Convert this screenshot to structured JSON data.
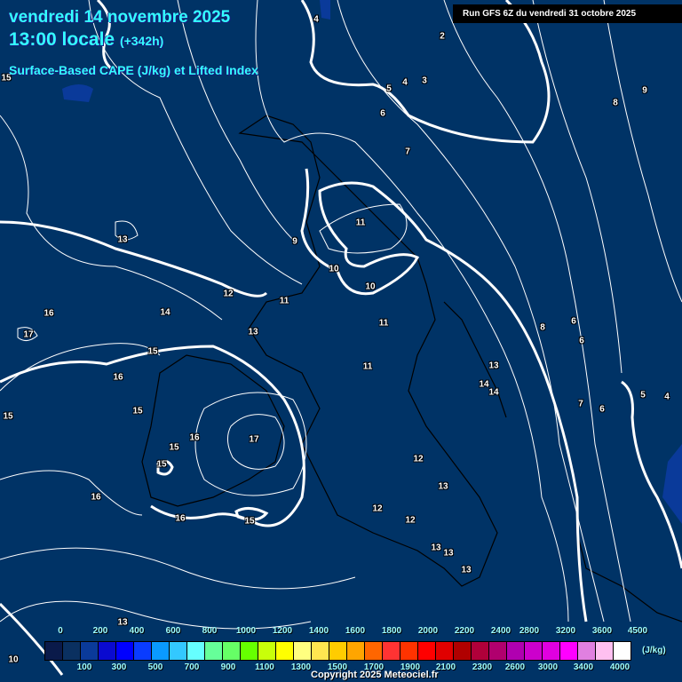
{
  "header": {
    "date": "vendredi 14 novembre 2025",
    "time": "13:00 locale",
    "lead": "(+342h)",
    "parameter": "Surface-Based CAPE (J/kg) et Lifted Index",
    "run": "Run GFS 6Z du vendredi 31 octobre 2025"
  },
  "colors": {
    "background": "#003366",
    "contour": "#ffffff",
    "coastline": "#000000",
    "cape_patch": "#0a3a9a"
  },
  "contour_labels": [
    4,
    2,
    5,
    4,
    3,
    15,
    6,
    7,
    8,
    9,
    11,
    13,
    9,
    10,
    10,
    12,
    11,
    16,
    14,
    11,
    6,
    8,
    6,
    17,
    13,
    15,
    11,
    13,
    16,
    14,
    14,
    5,
    4,
    7,
    6,
    15,
    15,
    16,
    17,
    15,
    15,
    12,
    13,
    16,
    12,
    12,
    16,
    15,
    13,
    13,
    13,
    13,
    10
  ],
  "legend": {
    "unit": "(J/kg)",
    "top_labels": [
      "0",
      "200",
      "400",
      "600",
      "800",
      "1000",
      "1200",
      "1400",
      "1600",
      "1800",
      "2000",
      "2200",
      "2400",
      "2800",
      "3200",
      "3600",
      "4500"
    ],
    "bottom_labels": [
      "100",
      "300",
      "500",
      "700",
      "900",
      "1100",
      "1300",
      "1500",
      "1700",
      "1900",
      "2100",
      "2300",
      "2600",
      "3000",
      "3400",
      "4000"
    ],
    "swatches": [
      "#0a1a4a",
      "#0a3060",
      "#0a3a9a",
      "#0a0ad0",
      "#0000ff",
      "#0a3cff",
      "#0a9aff",
      "#33c8ff",
      "#66ffff",
      "#66ff99",
      "#66ff66",
      "#66ff00",
      "#c8ff0a",
      "#ffff00",
      "#ffff80",
      "#ffe650",
      "#ffcc00",
      "#ffa500",
      "#ff6600",
      "#ff3333",
      "#ff3300",
      "#ff0000",
      "#e00000",
      "#b00000",
      "#b0003a",
      "#b0006e",
      "#b000b0",
      "#cc00cc",
      "#e000e0",
      "#ff00ff",
      "#e080e0",
      "#ffc0f0",
      "#ffffff"
    ]
  },
  "copyright": "Copyright 2025 Meteociel.fr"
}
